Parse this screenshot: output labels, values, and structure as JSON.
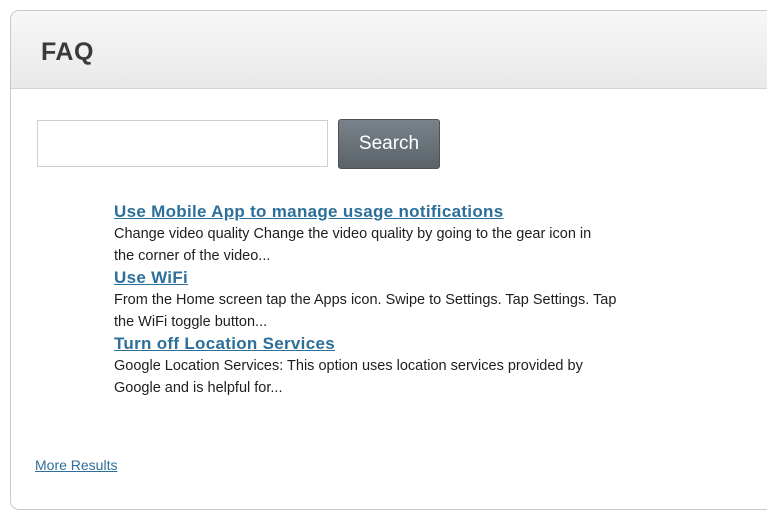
{
  "faq": {
    "title": "FAQ",
    "search": {
      "value": "",
      "placeholder": "",
      "button_label": "Search"
    },
    "results": [
      {
        "title": "Use Mobile App to manage usage notifications",
        "snippet": "Change video quality Change the video quality by going to the gear icon in\nthe corner of the video..."
      },
      {
        "title": "Use WiFi",
        "snippet": "From the Home screen tap the Apps icon. Swipe to Settings. Tap Settings. Tap\nthe WiFi toggle button..."
      },
      {
        "title": "Turn off Location Services",
        "snippet": "Google Location Services: This option uses location services provided by\nGoogle and is helpful for..."
      }
    ],
    "more_results_label": "More Results"
  }
}
